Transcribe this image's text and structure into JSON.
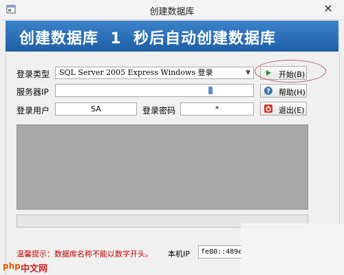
{
  "window": {
    "title": "创建数据库"
  },
  "banner": {
    "text": "创建数据库  1  秒后自动创建数据库"
  },
  "form": {
    "login_type_label": "登录类型",
    "login_type_value": "SQL Server 2005 Express Windows 登录",
    "server_ip_label": "服务器IP",
    "server_ip_value": "",
    "login_user_label": "登录用户",
    "login_user_value": "SA",
    "password_label": "登录密码",
    "password_value": "*"
  },
  "buttons": {
    "start": "开始(B)",
    "help": "帮助(H)",
    "exit": "退出(E)"
  },
  "footer": {
    "tip": "温馨提示：数据库名称不能以数字开头。",
    "local_ip_label": "本机IP",
    "local_ip_value": "fe80::489e"
  },
  "watermark": {
    "logo": "php",
    "text": "中文网"
  },
  "colors": {
    "banner": "#2a6db5",
    "tip": "#c00000",
    "annotation": "#c2576a"
  },
  "icons": [
    "app-icon",
    "close-icon",
    "dropdown-arrow-icon",
    "play-icon",
    "help-icon",
    "exit-icon"
  ]
}
